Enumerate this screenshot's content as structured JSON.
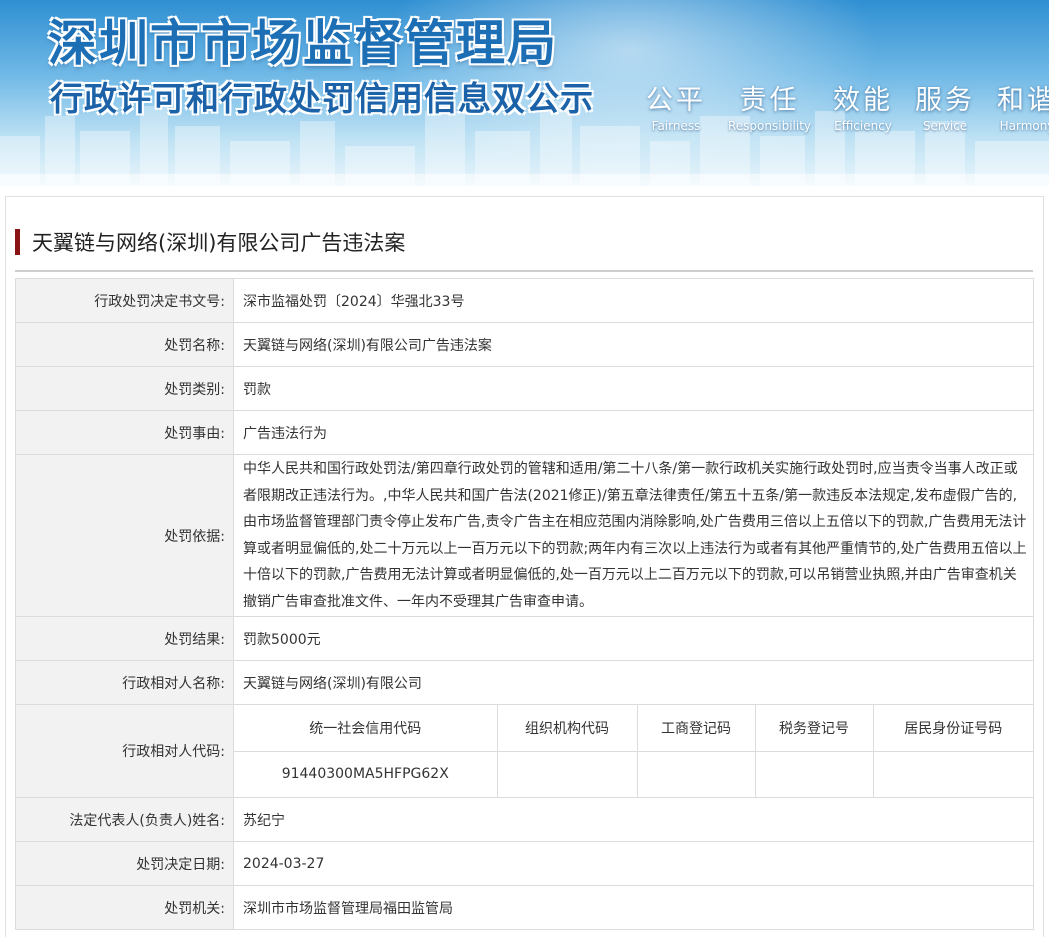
{
  "header": {
    "title": "深圳市市场监督管理局",
    "subtitle": "行政许可和行政处罚信用信息双公示",
    "slogans": [
      {
        "cn": "公平",
        "en": "Fairness"
      },
      {
        "cn": "责任",
        "en": "Responsibility"
      },
      {
        "cn": "效能",
        "en": "Efficiency"
      },
      {
        "cn": "服务",
        "en": "Service"
      },
      {
        "cn": "和谐",
        "en": "Harmony"
      }
    ],
    "colors": {
      "sky_top": "#2f8fd2",
      "sky_bottom": "#e9f5fb",
      "title_blue": "#1d6fb5"
    }
  },
  "case": {
    "title": "天翼链与网络(深圳)有限公司广告违法案",
    "accent": "#8a1414",
    "rows": {
      "doc_no": {
        "label": "行政处罚决定书文号:",
        "value": "深市监福处罚〔2024〕华强北33号"
      },
      "name": {
        "label": "处罚名称:",
        "value": "天翼链与网络(深圳)有限公司广告违法案"
      },
      "category": {
        "label": "处罚类别:",
        "value": "罚款"
      },
      "reason": {
        "label": "处罚事由:",
        "value": "广告违法行为"
      },
      "basis": {
        "label": "处罚依据:",
        "value": "中华人民共和国行政处罚法/第四章行政处罚的管辖和适用/第二十八条/第一款行政机关实施行政处罚时,应当责令当事人改正或者限期改正违法行为。,中华人民共和国广告法(2021修正)/第五章法律责任/第五十五条/第一款违反本法规定,发布虚假广告的,由市场监督管理部门责令停止发布广告,责令广告主在相应范围内消除影响,处广告费用三倍以上五倍以下的罚款,广告费用无法计算或者明显偏低的,处二十万元以上一百万元以下的罚款;两年内有三次以上违法行为或者有其他严重情节的,处广告费用五倍以上十倍以下的罚款,广告费用无法计算或者明显偏低的,处一百万元以上二百万元以下的罚款,可以吊销营业执照,并由广告审查机关撤销广告审查批准文件、一年内不受理其广告审查申请。"
      },
      "result": {
        "label": "处罚结果:",
        "value": "罚款5000元"
      },
      "party": {
        "label": "行政相对人名称:",
        "value": "天翼链与网络(深圳)有限公司"
      },
      "codes": {
        "label": "行政相对人代码:",
        "headers": [
          "统一社会信用代码",
          "组织机构代码",
          "工商登记码",
          "税务登记号",
          "居民身份证号码"
        ],
        "values": [
          "91440300MA5HFPG62X",
          "",
          "",
          "",
          ""
        ]
      },
      "legal_rep": {
        "label": "法定代表人(负责人)姓名:",
        "value": "苏纪宁"
      },
      "date": {
        "label": "处罚决定日期:",
        "value": "2024-03-27"
      },
      "authority": {
        "label": "处罚机关:",
        "value": "深圳市市场监督管理局福田监管局"
      }
    }
  }
}
